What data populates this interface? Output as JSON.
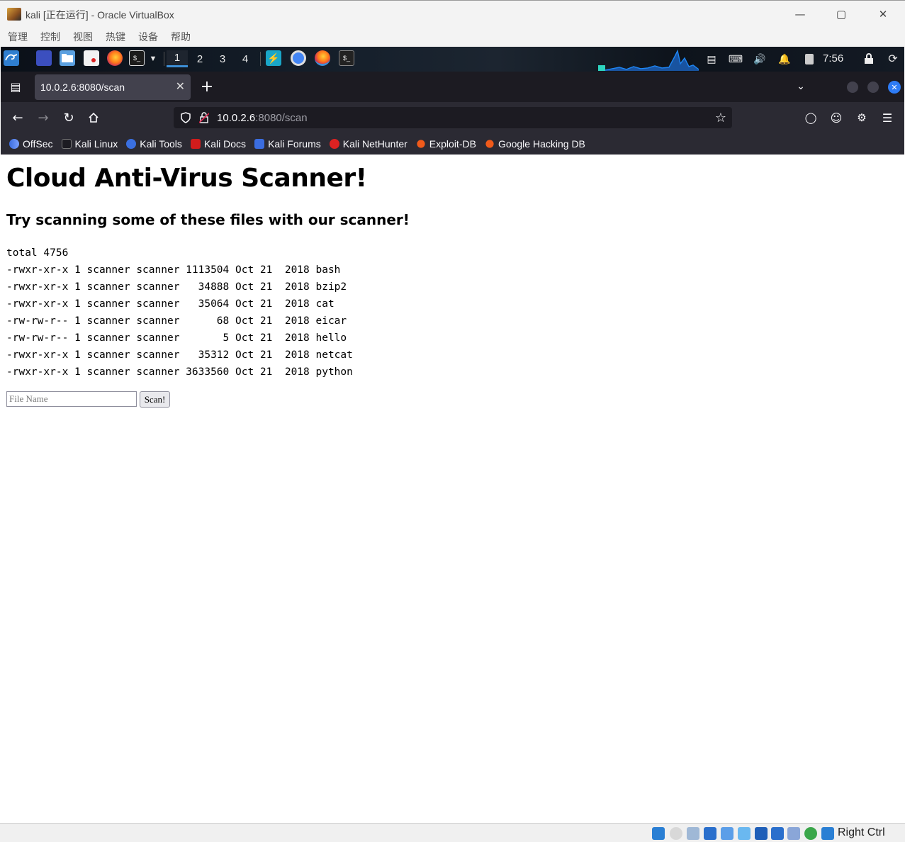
{
  "vbox": {
    "title": "kali [正在运行] - Oracle VirtualBox",
    "menu": [
      "管理",
      "控制",
      "视图",
      "热键",
      "设备",
      "帮助"
    ],
    "status_right": "Right Ctrl"
  },
  "panel": {
    "workspaces": [
      "1",
      "2",
      "3",
      "4"
    ],
    "active_workspace": "1",
    "clock": "7:56"
  },
  "browser": {
    "tab_title": "10.0.2.6:8080/scan",
    "url_host": "10.0.2.6",
    "url_rest": ":8080/scan",
    "bookmarks": [
      "OffSec",
      "Kali Linux",
      "Kali Tools",
      "Kali Docs",
      "Kali Forums",
      "Kali NetHunter",
      "Exploit-DB",
      "Google Hacking DB"
    ]
  },
  "page": {
    "heading": "Cloud Anti-Virus Scanner!",
    "subheading": "Try scanning some of these files with our scanner!",
    "listing": "total 4756\n-rwxr-xr-x 1 scanner scanner 1113504 Oct 21  2018 bash\n-rwxr-xr-x 1 scanner scanner   34888 Oct 21  2018 bzip2\n-rwxr-xr-x 1 scanner scanner   35064 Oct 21  2018 cat\n-rw-rw-r-- 1 scanner scanner      68 Oct 21  2018 eicar\n-rw-rw-r-- 1 scanner scanner       5 Oct 21  2018 hello\n-rwxr-xr-x 1 scanner scanner   35312 Oct 21  2018 netcat\n-rwxr-xr-x 1 scanner scanner 3633560 Oct 21  2018 python",
    "input_placeholder": "File Name",
    "input_value": "",
    "button_label": "Scan!"
  }
}
